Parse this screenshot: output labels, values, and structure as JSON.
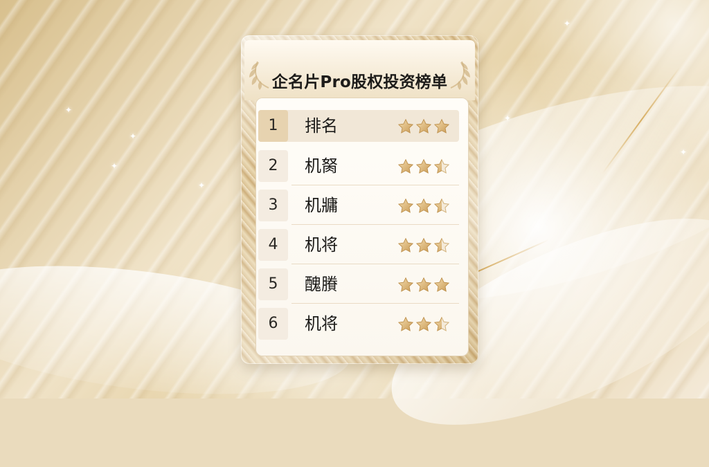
{
  "title": "企名片Pro股权投资榜单",
  "rankings": [
    {
      "rank": "1",
      "name": "排名",
      "rating": 3
    },
    {
      "rank": "2",
      "name": "机胬",
      "rating": 2.5
    },
    {
      "rank": "3",
      "name": "机牅",
      "rating": 2.5
    },
    {
      "rank": "4",
      "name": "机将",
      "rating": 2.5
    },
    {
      "rank": "5",
      "name": "醜賸",
      "rating": 3
    },
    {
      "rank": "6",
      "name": "机将",
      "rating": 2.5
    }
  ],
  "colors": {
    "gold": "#c99a55",
    "light_gold": "#f0dfb9",
    "frame": "#d9bf8c",
    "panel": "#fffdf8"
  },
  "icons": {
    "rating": "star-icon",
    "decoration": "laurel-icon"
  }
}
